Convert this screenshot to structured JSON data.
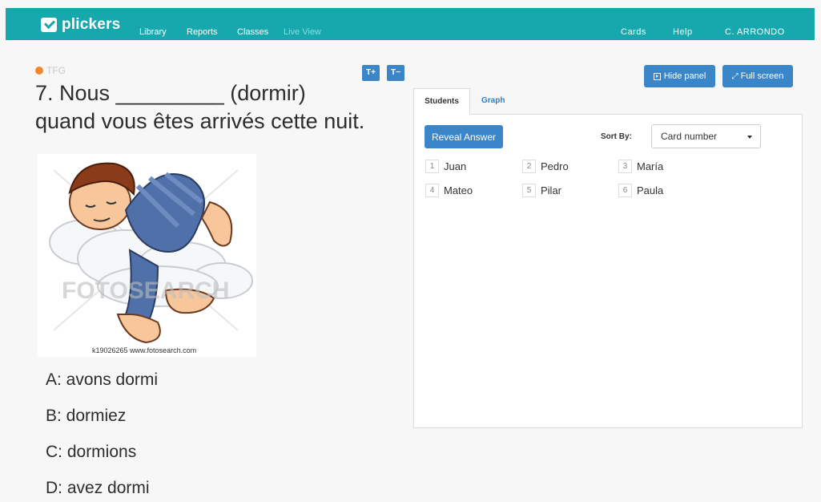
{
  "header": {
    "brand": "plickers",
    "nav": [
      {
        "label": "Library"
      },
      {
        "label": "Reports"
      },
      {
        "label": "Classes"
      },
      {
        "label": "Live View"
      }
    ],
    "right": [
      {
        "label": "Cards"
      },
      {
        "label": "Help"
      },
      {
        "label": "C. ARRONDO"
      }
    ],
    "bg_color": "#17a8ae"
  },
  "question": {
    "set_tag": "TFG",
    "text_line1": "7. Nous _________ (dormir)",
    "text_line2": "quand vous êtes arrivés cette nuit.",
    "font_increase": "T+",
    "font_decrease": "T−",
    "image_caption": "k19026265 www.fotosearch.com",
    "image_watermark": "FOTOSEARCH",
    "answers": [
      {
        "label": "A: avons dormi"
      },
      {
        "label": "B: dormiez"
      },
      {
        "label": "C: dormions"
      },
      {
        "label": "D: avez dormi"
      }
    ]
  },
  "panel": {
    "hide_label": "Hide panel",
    "fullscreen_label": "Full screen",
    "tabs": [
      {
        "label": "Students"
      },
      {
        "label": "Graph"
      }
    ],
    "reveal_label": "Reveal Answer",
    "sort_label": "Sort By:",
    "sort_value": "Card number",
    "students": [
      {
        "num": "1",
        "name": "Juan"
      },
      {
        "num": "2",
        "name": "Pedro"
      },
      {
        "num": "3",
        "name": "María"
      },
      {
        "num": "4",
        "name": "Mateo"
      },
      {
        "num": "5",
        "name": "Pilar"
      },
      {
        "num": "6",
        "name": "Paula"
      }
    ],
    "accent_color": "#3a86c9"
  }
}
